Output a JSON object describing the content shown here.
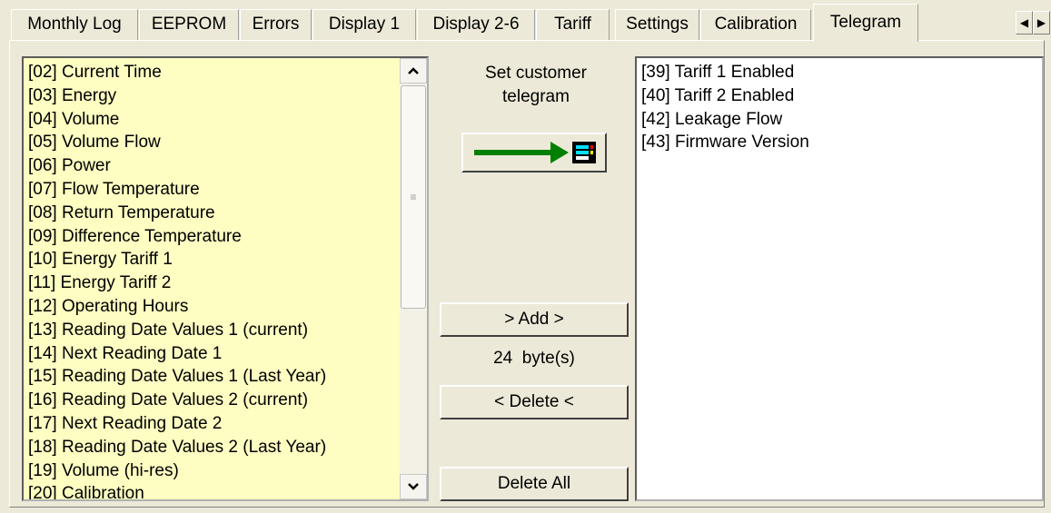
{
  "tabs": [
    {
      "label": "Monthly Log"
    },
    {
      "label": "EEPROM"
    },
    {
      "label": "Errors"
    },
    {
      "label": "Display 1"
    },
    {
      "label": "Display 2-6"
    },
    {
      "label": "Tariff"
    },
    {
      "label": "Settings"
    },
    {
      "label": "Calibration"
    },
    {
      "label": "Telegram",
      "active": true
    }
  ],
  "available_list": {
    "items": [
      "[02] Current Time",
      "[03] Energy",
      "[04] Volume",
      "[05] Volume Flow",
      "[06] Power",
      "[07] Flow Temperature",
      "[08] Return Temperature",
      "[09] Difference Temperature",
      "[10] Energy Tariff 1",
      "[11] Energy Tariff 2",
      "[12] Operating Hours",
      "[13] Reading Date Values 1 (current)",
      "[14] Next Reading Date 1",
      "[15] Reading Date Values 1 (Last Year)",
      "[16] Reading Date Values 2 (current)",
      "[17] Next Reading Date 2",
      "[18] Reading Date Values 2 (Last Year)",
      "[19] Volume (hi-res)",
      "[20] Calibration"
    ]
  },
  "selected_list": {
    "items": [
      "[39] Tariff 1 Enabled",
      "[40] Tariff 2 Enabled",
      "[42] Leakage Flow",
      "[43] Firmware Version"
    ]
  },
  "controls": {
    "caption": "Set customer telegram",
    "add_label": "> Add >",
    "byte_count": "24  byte(s)",
    "delete_label": "< Delete <",
    "delete_all_label": "Delete All",
    "transfer_icon": "arrow-to-meter-icon",
    "arrow_color": "#008000"
  },
  "colors": {
    "available_bg": "#fefdc2",
    "window_bg": "#ece9d8"
  }
}
